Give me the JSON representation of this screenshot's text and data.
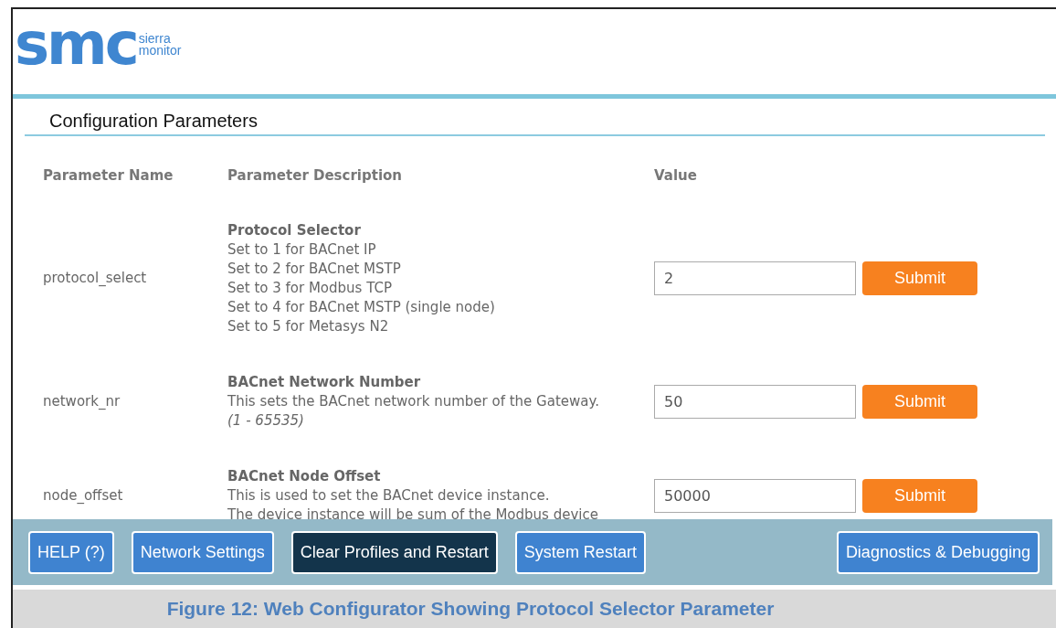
{
  "logo": {
    "mark": "smc",
    "tagline": [
      "sierra",
      "monitor"
    ]
  },
  "title": "Configuration Parameters",
  "columns": [
    "Parameter Name",
    "Parameter Description",
    "Value"
  ],
  "rows": [
    {
      "name": "protocol_select",
      "heading": "Protocol Selector",
      "lines": [
        "Set to 1 for BACnet IP",
        "Set to 2 for BACnet MSTP",
        "Set to 3 for Modbus TCP",
        "Set to 4 for BACnet MSTP (single node)",
        "Set to 5 for Metasys N2"
      ],
      "value": "2",
      "button": "Submit"
    },
    {
      "name": "network_nr",
      "heading": "BACnet Network Number",
      "lines": [
        "This sets the BACnet network number of the Gateway."
      ],
      "note": "(1 - 65535)",
      "value": "50",
      "button": "Submit"
    },
    {
      "name": "node_offset",
      "heading": "BACnet Node Offset",
      "lines": [
        "This is used to set the BACnet device instance.",
        "The device instance will be sum of the Modbus device"
      ],
      "value": "50000",
      "button": "Submit"
    }
  ],
  "footer_buttons": [
    {
      "label": "HELP (?)",
      "kind": "normal"
    },
    {
      "label": "Network Settings",
      "kind": "normal"
    },
    {
      "label": "Clear Profiles and Restart",
      "kind": "dark"
    },
    {
      "label": "System Restart",
      "kind": "normal"
    },
    {
      "label": "Diagnostics & Debugging",
      "kind": "normal"
    }
  ],
  "caption": "Figure 12: Web Configurator Showing Protocol Selector Parameter"
}
